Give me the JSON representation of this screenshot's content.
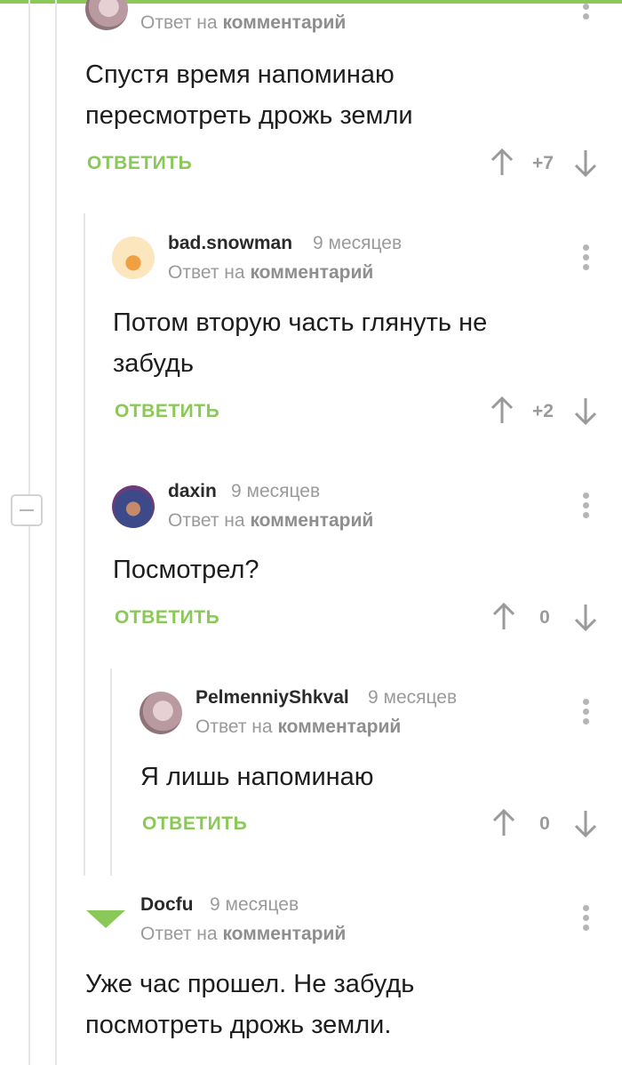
{
  "labels": {
    "reply_prefix": "Ответ на",
    "reply_target": "комментарий",
    "reply_button": "ОТВЕТИТЬ"
  },
  "colors": {
    "accent": "#8ac858",
    "muted": "#9a9a9a"
  },
  "comments": [
    {
      "username": "",
      "time": "",
      "text_lines": [
        "Спустя время напоминаю",
        "пересмотреть дрожь земли"
      ],
      "score": "+7"
    },
    {
      "username": "bad.snowman",
      "time": "9 месяцев",
      "text_lines": [
        "Потом вторую часть глянуть не",
        "забудь"
      ],
      "score": "+2"
    },
    {
      "username": "daxin",
      "time": "9 месяцев",
      "text_lines": [
        "Посмотрел?"
      ],
      "score": "0"
    },
    {
      "username": "PelmenniyShkval",
      "time": "9 месяцев",
      "text_lines": [
        "Я лишь напоминаю"
      ],
      "score": "0"
    },
    {
      "username": "Docfu",
      "time": "9 месяцев",
      "text_lines": [
        "Уже час прошел. Не забудь",
        "посмотреть дрожь земли."
      ],
      "score": ""
    }
  ]
}
